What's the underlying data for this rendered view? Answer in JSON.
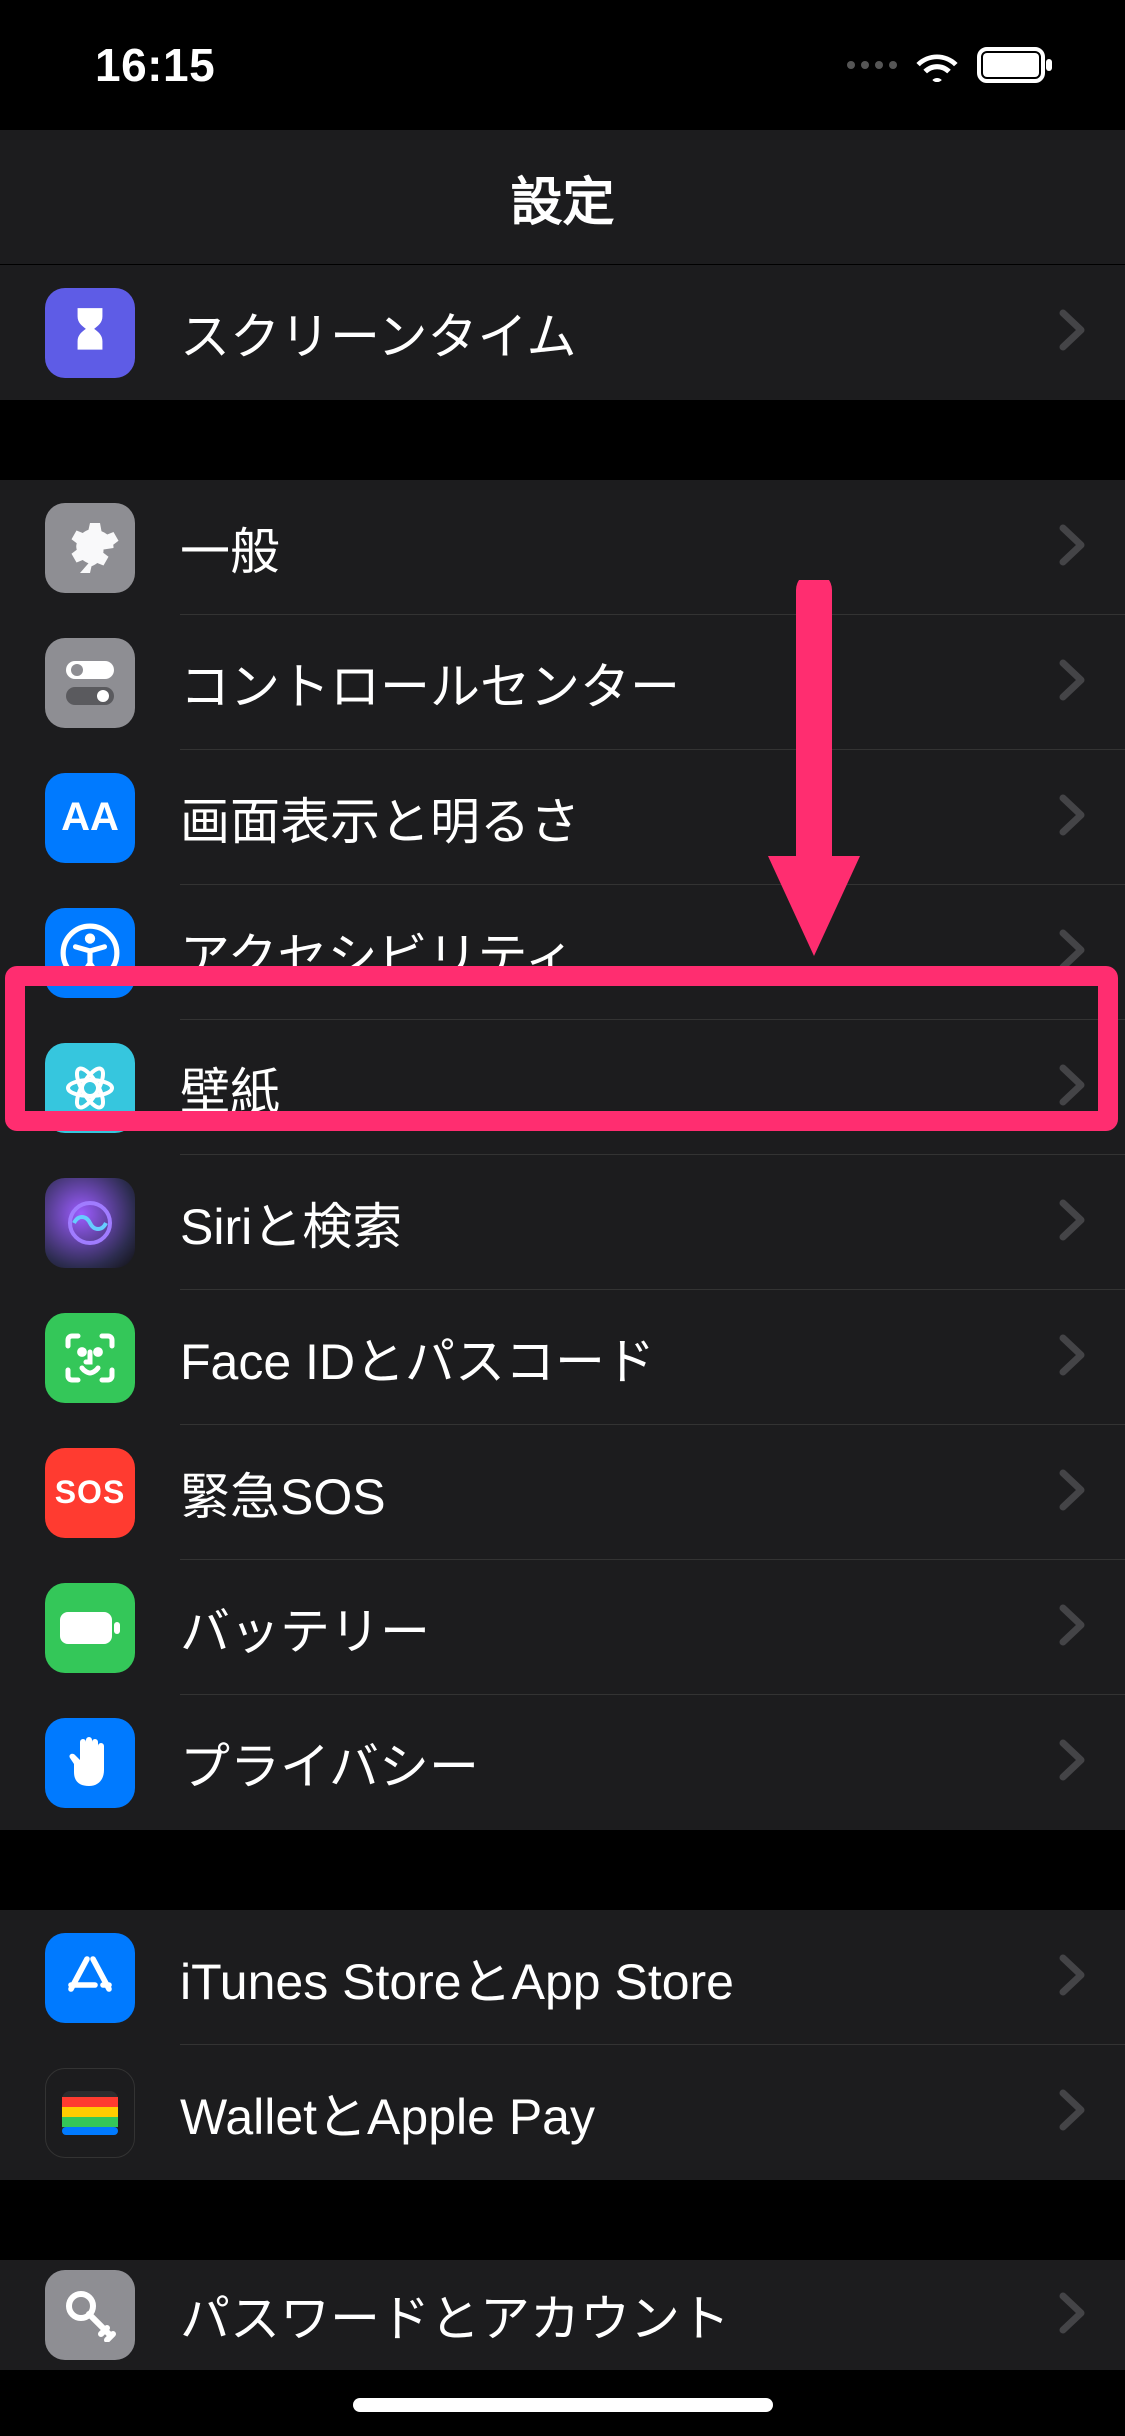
{
  "status": {
    "time": "16:15"
  },
  "nav": {
    "title": "設定"
  },
  "section_top": [
    {
      "label": "スクリーンタイム",
      "icon": "hourglass-icon"
    }
  ],
  "section_general": [
    {
      "label": "一般",
      "icon": "gear-icon"
    },
    {
      "label": "コントロールセンター",
      "icon": "toggles-icon"
    },
    {
      "label": "画面表示と明るさ",
      "icon": "text-size-icon"
    },
    {
      "label": "アクセシビリティ",
      "icon": "accessibility-icon"
    },
    {
      "label": "壁紙",
      "icon": "wallpaper-icon"
    },
    {
      "label": "Siriと検索",
      "icon": "siri-icon"
    },
    {
      "label": "Face IDとパスコード",
      "icon": "faceid-icon"
    },
    {
      "label": "緊急SOS",
      "icon": "sos-icon",
      "icon_text": "SOS"
    },
    {
      "label": "バッテリー",
      "icon": "battery-icon-row"
    },
    {
      "label": "プライバシー",
      "icon": "hand-icon"
    }
  ],
  "section_store": [
    {
      "label": "iTunes StoreとApp Store",
      "icon": "appstore-icon"
    },
    {
      "label": "WalletとApple Pay",
      "icon": "wallet-icon"
    }
  ],
  "section_accounts": [
    {
      "label": "パスワードとアカウント",
      "icon": "key-icon"
    }
  ],
  "annotation": {
    "highlighted_item": "壁紙",
    "arrow_color": "#ff2d70"
  }
}
